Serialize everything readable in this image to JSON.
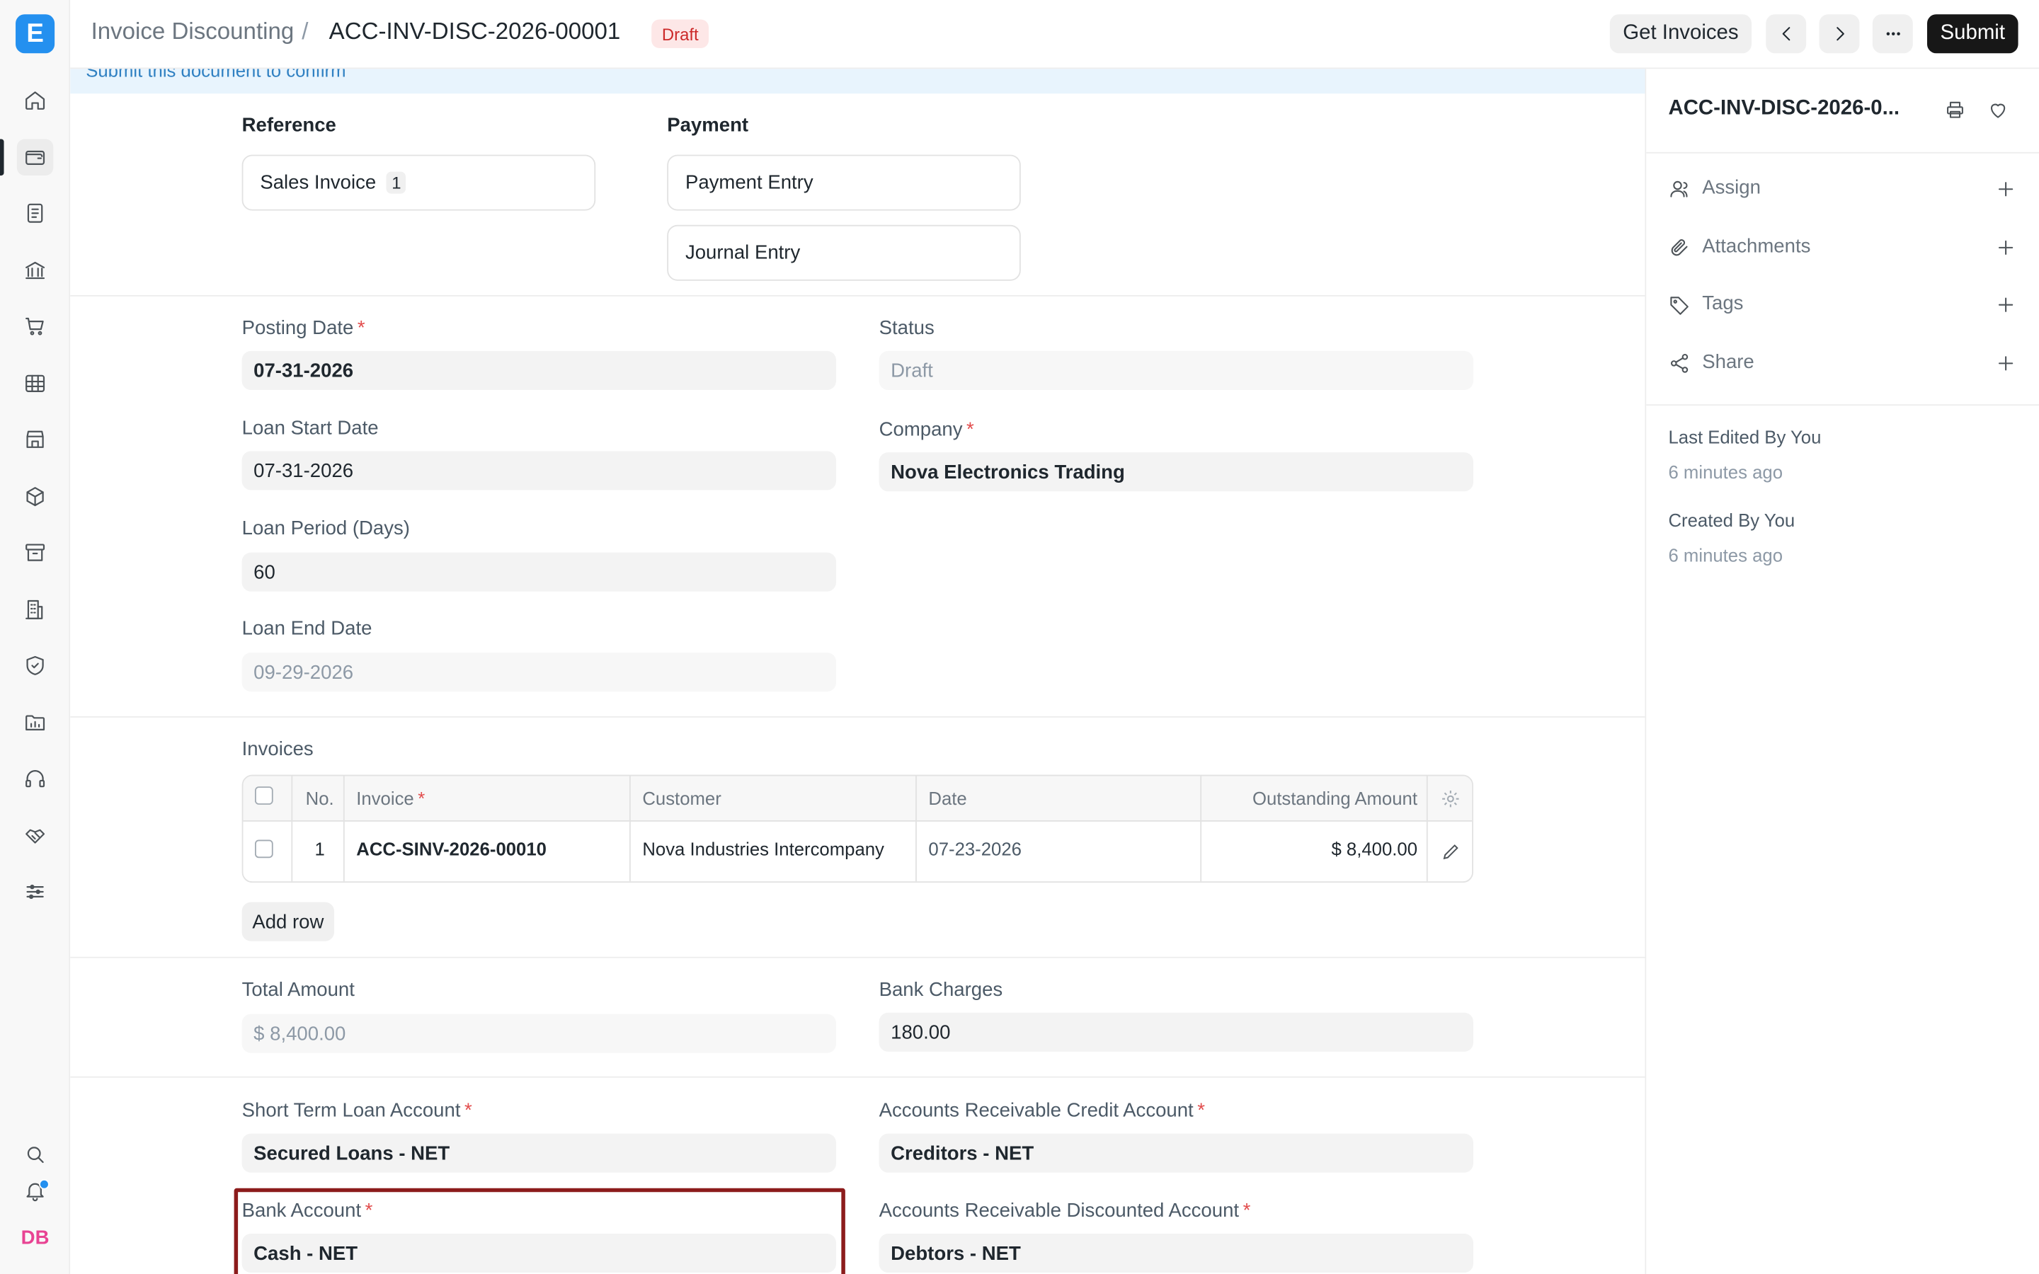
{
  "topbar": {
    "breadcrumb_parent": "Invoice Discounting",
    "breadcrumb_sep": "/",
    "doc_name": "ACC-INV-DISC-2026-00001",
    "status_badge": "Draft",
    "get_invoices_label": "Get Invoices",
    "submit_label": "Submit"
  },
  "notice": "Submit this document to confirm",
  "reference": {
    "reference_label": "Reference",
    "sales_invoice_label": "Sales Invoice",
    "sales_invoice_count": "1",
    "payment_label": "Payment",
    "payment_entry_label": "Payment Entry",
    "journal_entry_label": "Journal Entry"
  },
  "dates": {
    "posting_date_label": "Posting Date",
    "posting_date": "07-31-2026",
    "loan_start_label": "Loan Start Date",
    "loan_start": "07-31-2026",
    "loan_period_label": "Loan Period (Days)",
    "loan_period": "60",
    "loan_end_label": "Loan End Date",
    "loan_end": "09-29-2026",
    "status_label": "Status",
    "status": "Draft",
    "company_label": "Company",
    "company": "Nova Electronics Trading"
  },
  "invoices": {
    "section_label": "Invoices",
    "columns": {
      "no": "No.",
      "invoice": "Invoice",
      "customer": "Customer",
      "date": "Date",
      "outstanding": "Outstanding Amount"
    },
    "rows": [
      {
        "no": "1",
        "invoice": "ACC-SINV-2026-00010",
        "customer": "Nova Industries Intercompany",
        "date": "07-23-2026",
        "outstanding": "$ 8,400.00"
      }
    ],
    "add_row_label": "Add row"
  },
  "amounts": {
    "total_label": "Total Amount",
    "total": "$ 8,400.00",
    "bank_charges_label": "Bank Charges",
    "bank_charges": "180.00"
  },
  "accounts": {
    "short_term_label": "Short Term Loan Account",
    "short_term": "Secured Loans - NET",
    "ar_credit_label": "Accounts Receivable Credit Account",
    "ar_credit": "Creditors - NET",
    "bank_account_label": "Bank Account",
    "bank_account": "Cash - NET",
    "ar_discounted_label": "Accounts Receivable Discounted Account",
    "ar_discounted": "Debtors - NET"
  },
  "sidebar": {
    "title": "ACC-INV-DISC-2026-0...",
    "assign": "Assign",
    "attachments": "Attachments",
    "tags": "Tags",
    "share": "Share",
    "last_edited": "Last Edited By You",
    "last_edited_time": "6 minutes ago",
    "created": "Created By You",
    "created_time": "6 minutes ago"
  },
  "rail": {
    "logo_letter": "E",
    "avatar_initials": "DB"
  },
  "colors": {
    "primary_button": "#171717",
    "logo_blue": "#2490ef",
    "draft_badge_bg": "#fde7e7",
    "draft_badge_text": "#cc2929",
    "highlight_border": "#8c1c1c",
    "required_marker": "#e24c4c"
  },
  "icons": [
    "home-icon",
    "wallet-icon",
    "document-icon",
    "bank-icon",
    "cart-icon",
    "table-icon",
    "store-icon",
    "package-icon",
    "archive-icon",
    "building-icon",
    "shield-icon",
    "folder-chart-icon",
    "headset-icon",
    "handshake-icon",
    "sliders-icon",
    "search-icon",
    "bell-icon",
    "printer-icon",
    "heart-icon",
    "user-icon",
    "paperclip-icon",
    "tag-icon",
    "share-icon",
    "plus-icon",
    "gear-icon",
    "pencil-icon",
    "chevron-left-icon",
    "chevron-right-icon",
    "ellipsis-icon"
  ]
}
